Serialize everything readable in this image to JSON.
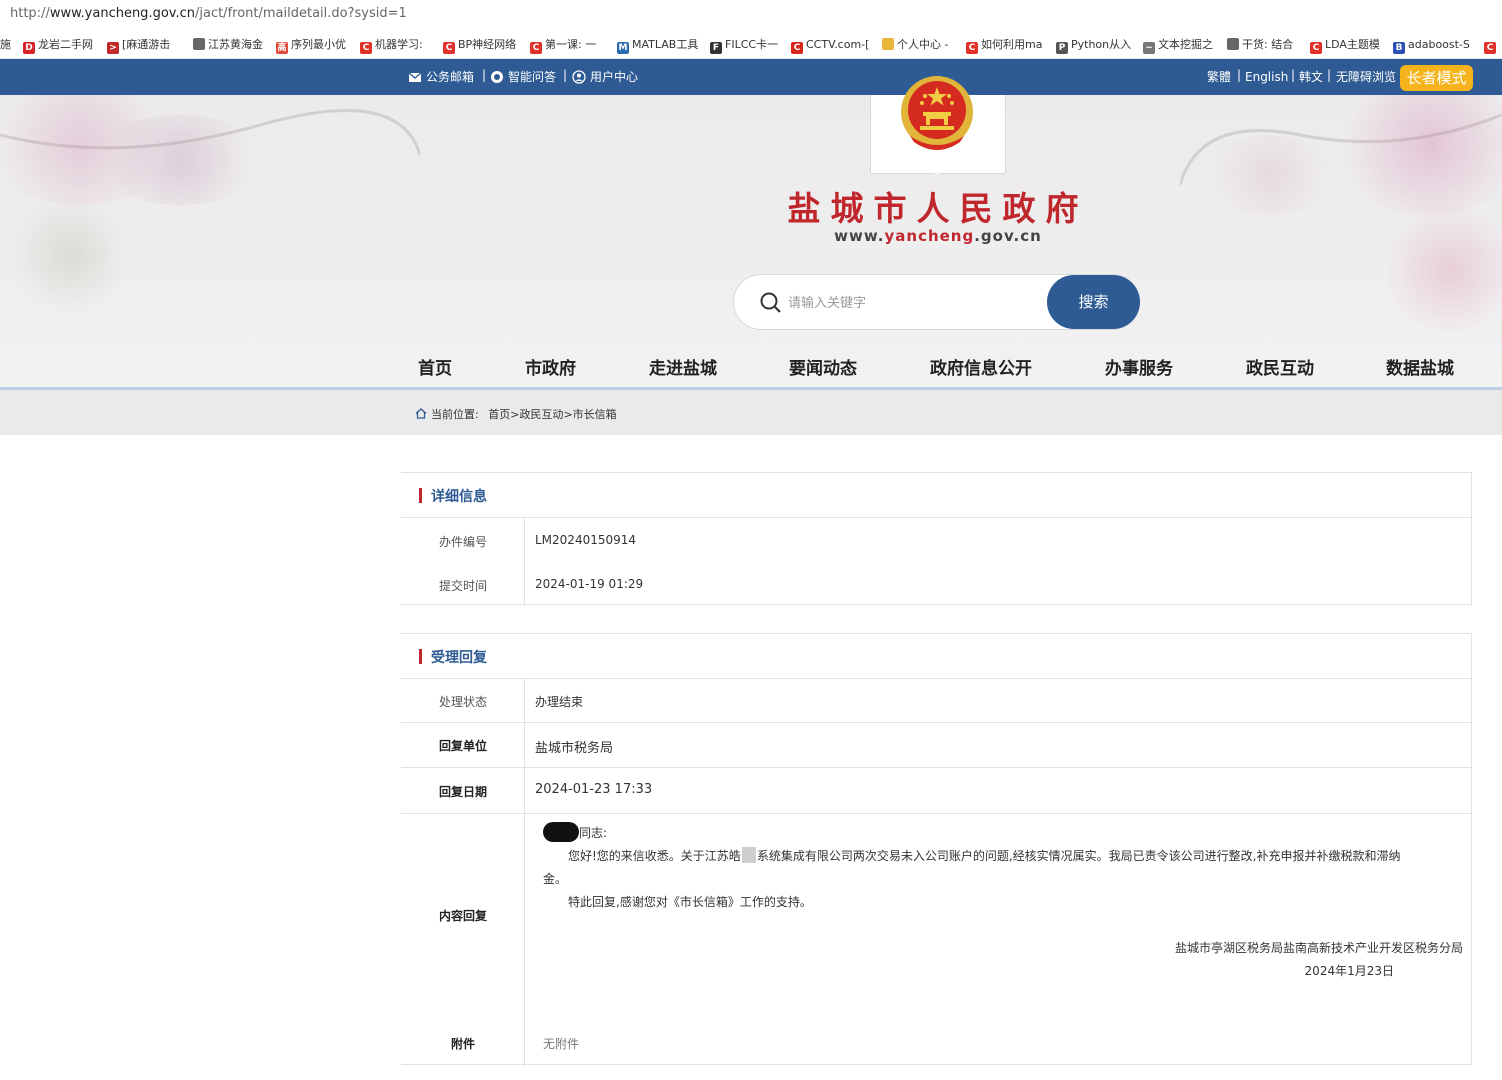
{
  "browser": {
    "url": "http://www.yancheng.gov.cn/jact/front/maildetail.do?sysid=1",
    "url_prefix": "http://",
    "url_host": "www.yancheng.gov.cn",
    "url_path": "/jact/front/maildetail.do?sysid=1",
    "bookmarks": [
      {
        "label": "施",
        "icon": "blank"
      },
      {
        "label": "龙岩二手网",
        "icon": "dk-logo-icon"
      },
      {
        "label": "[麻通游击",
        "icon": "arrow-icon"
      },
      {
        "label": "江苏黄海金",
        "icon": "page-icon"
      },
      {
        "label": "序列最小优",
        "icon": "hao-icon"
      },
      {
        "label": "机器学习:",
        "icon": "csdn-icon"
      },
      {
        "label": "BP神经网络",
        "icon": "csdn-icon"
      },
      {
        "label": "第一课: 一",
        "icon": "csdn-icon"
      },
      {
        "label": "MATLAB工具",
        "icon": "matlab-icon"
      },
      {
        "label": "FILCC卡一",
        "icon": "square-icon"
      },
      {
        "label": "CCTV.com-[",
        "icon": "cctv-icon"
      },
      {
        "label": "个人中心 -",
        "icon": "folder-icon"
      },
      {
        "label": "如何利用ma",
        "icon": "csdn-icon"
      },
      {
        "label": "Python从入",
        "icon": "python-icon"
      },
      {
        "label": "文本挖掘之",
        "icon": "paw-icon"
      },
      {
        "label": "干货: 结合",
        "icon": "page-icon"
      },
      {
        "label": "LDA主题模",
        "icon": "csdn-icon"
      },
      {
        "label": "adaboost-S",
        "icon": "baidu-icon"
      },
      {
        "label": "",
        "icon": "csdn-icon"
      }
    ]
  },
  "topbar": {
    "mail": "公务邮箱",
    "ai": "智能问答",
    "user": "用户中心",
    "traditional": "繁體",
    "english": "English",
    "korean": "韩文",
    "accessible": "无障碍浏览",
    "elder": "长者模式"
  },
  "header": {
    "title": "盐城市人民政府",
    "url_a": "www.",
    "url_b": "yancheng",
    "url_c": ".gov.cn",
    "search_placeholder": "请输入关键字",
    "search_button": "搜索"
  },
  "nav": [
    "首页",
    "市政府",
    "走进盐城",
    "要闻动态",
    "政府信息公开",
    "办事服务",
    "政民互动",
    "数据盐城"
  ],
  "breadcrumb": {
    "prefix": "当前位置:",
    "home": "首页",
    "sep": ">",
    "level2": "政民互动",
    "level3": "市长信箱"
  },
  "detail": {
    "title": "详细信息",
    "rows": [
      {
        "label": "办件编号",
        "value": "LM20240150914"
      },
      {
        "label": "提交时间",
        "value": "2024-01-19 01:29"
      }
    ]
  },
  "reply": {
    "title": "受理回复",
    "status_label": "处理状态",
    "status_value": "办理结束",
    "unit_label": "回复单位",
    "unit_value": "盐城市税务局",
    "date_label": "回复日期",
    "date_value": "2024-01-23 17:33",
    "content_label": "内容回复",
    "greeting": "同志:",
    "para1_a": "您好!您的来信收悉。关于江苏皓",
    "para1_b": "系统集成有限公司两次交易未入公司账户的问题,经核实情况属实。我局已责令该公司进行整改,补充申报并补缴税款和滞纳",
    "para1_c": "金。",
    "para2": "特此回复,感谢您对《市长信箱》工作的支持。",
    "signature": "盐城市亭湖区税务局盐南高新技术产业开发区税务分局",
    "sign_date": "2024年1月23日",
    "attach_label": "附件",
    "attach_value": "无附件"
  },
  "colors": {
    "gov_blue": "#2e5b93",
    "gov_red": "#c0272d",
    "elder_orange": "#f6b41c"
  }
}
